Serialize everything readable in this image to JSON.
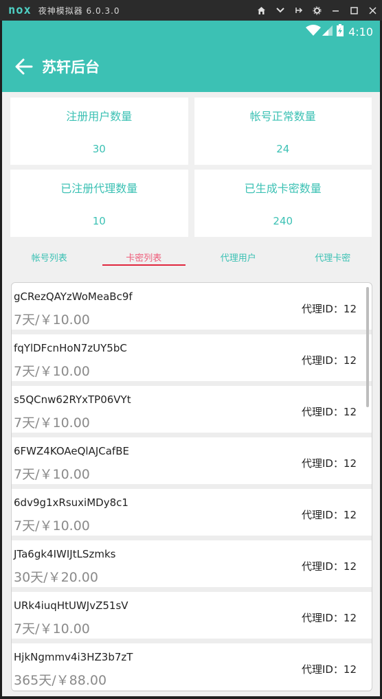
{
  "emulator": {
    "logo": "nox",
    "title": "夜神模拟器 6.0.3.0",
    "controls": [
      "home-icon",
      "chevron-down-icon",
      "pin-icon",
      "gear-icon",
      "minimize-icon",
      "maximize-icon",
      "close-icon"
    ]
  },
  "status_bar": {
    "time": "4:10",
    "icons": [
      "wifi-icon",
      "signal-icon",
      "battery-icon"
    ]
  },
  "app_bar": {
    "title": "苏轩后台"
  },
  "stats": [
    {
      "label": "注册用户数量",
      "value": "30"
    },
    {
      "label": "帐号正常数量",
      "value": "24"
    },
    {
      "label": "已注册代理数量",
      "value": "10"
    },
    {
      "label": "已生成卡密数量",
      "value": "240"
    }
  ],
  "tabs": [
    {
      "label": "帐号列表",
      "active": false
    },
    {
      "label": "卡密列表",
      "active": true
    },
    {
      "label": "代理用户",
      "active": false
    },
    {
      "label": "代理卡密",
      "active": false
    }
  ],
  "cards": [
    {
      "code": "gCRezQAYzWoMeaBc9f",
      "price": "7天/￥10.00",
      "agent": "代理ID：12"
    },
    {
      "code": "fqYlDFcnHoN7zUY5bC",
      "price": "7天/￥10.00",
      "agent": "代理ID：12"
    },
    {
      "code": "s5QCnw62RYxTP06VYt",
      "price": "7天/￥10.00",
      "agent": "代理ID：12"
    },
    {
      "code": "6FWZ4KOAeQlAJCafBE",
      "price": "7天/￥10.00",
      "agent": "代理ID：12"
    },
    {
      "code": "6dv9g1xRsuxiMDy8c1",
      "price": "7天/￥10.00",
      "agent": "代理ID：12"
    },
    {
      "code": "JTa6gk4IWIJtLSzmks",
      "price": "30天/￥20.00",
      "agent": "代理ID：12"
    },
    {
      "code": "URk4iuqHtUWJvZ51sV",
      "price": "7天/￥10.00",
      "agent": "代理ID：12"
    },
    {
      "code": "HjkNgmmv4i3HZ3b7zT",
      "price": "365天/￥88.00",
      "agent": "代理ID：12"
    }
  ],
  "colors": {
    "accent": "#3cc1b4",
    "active_tab": "#ee5d7a",
    "underline": "#e0263e"
  }
}
